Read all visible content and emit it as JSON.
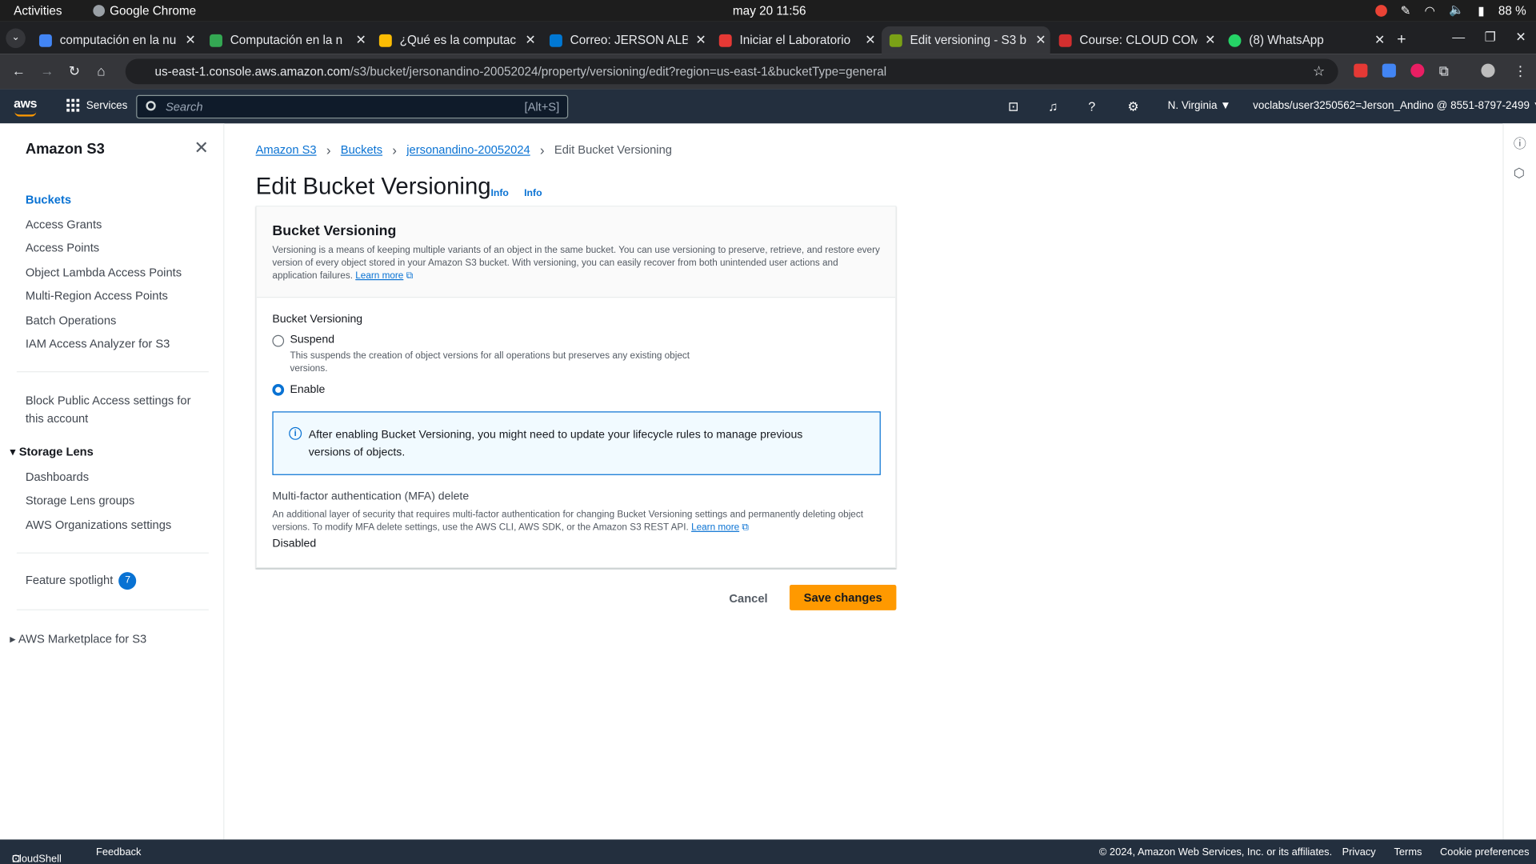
{
  "os": {
    "activities": "Activities",
    "app_name": "Google Chrome",
    "clock": "may 20  11:56",
    "battery": "88 %"
  },
  "browser": {
    "tabs": [
      {
        "title": "computación en la nu",
        "color": "#4285f4"
      },
      {
        "title": "Computación en la n",
        "color": "#34a853"
      },
      {
        "title": "¿Qué es la computac",
        "color": "#fbbc04"
      },
      {
        "title": "Correo: JERSON ALB",
        "color": "#0078d4"
      },
      {
        "title": "Iniciar el Laboratorio",
        "color": "#e53935"
      },
      {
        "title": "Edit versioning - S3 b",
        "color": "#7aa116"
      },
      {
        "title": "Course: CLOUD COM",
        "color": "#d32f2f"
      },
      {
        "title": "(8) WhatsApp",
        "color": "#25d366"
      }
    ],
    "url_host": "us-east-1.console.aws.amazon.com",
    "url_path": "/s3/bucket/jersonandino-20052024/property/versioning/edit?region=us-east-1&bucketType=general"
  },
  "aws": {
    "logo": "aws",
    "services_label": "Services",
    "search_placeholder": "Search",
    "search_shortcut": "[Alt+S]",
    "region": "N. Virginia ▼",
    "account": "voclabs/user3250562=Jerson_Andino @ 8551-8797-2499 ▼"
  },
  "sidebar": {
    "title": "Amazon S3",
    "items": [
      "Buckets",
      "Access Grants",
      "Access Points",
      "Object Lambda Access Points",
      "Multi-Region Access Points",
      "Batch Operations",
      "IAM Access Analyzer for S3"
    ],
    "block_public_1": "Block Public Access settings for",
    "block_public_2": "this account",
    "storage_lens": "Storage Lens",
    "storage_lens_items": [
      "Dashboards",
      "Storage Lens groups",
      "AWS Organizations settings"
    ],
    "feature_spotlight": "Feature spotlight",
    "feature_count": "7",
    "marketplace": "AWS Marketplace for S3"
  },
  "breadcrumb": [
    "Amazon S3",
    "Buckets",
    "jersonandino-20052024",
    "Edit Bucket Versioning"
  ],
  "page": {
    "title": "Edit Bucket Versioning",
    "info": "Info",
    "card_title": "Bucket Versioning",
    "card_desc": "Versioning is a means of keeping multiple variants of an object in the same bucket. You can use versioning to preserve, retrieve, and restore every version of every object stored in your Amazon S3 bucket. With versioning, you can easily recover from both unintended user actions and application failures.",
    "learn_more": "Learn more",
    "versioning_label": "Bucket Versioning",
    "suspend_label": "Suspend",
    "suspend_desc": "This suspends the creation of object versions for all operations but preserves any existing object versions.",
    "enable_label": "Enable",
    "selected": "Enable",
    "alert_text": "After enabling Bucket Versioning, you might need to update your lifecycle rules to manage previous versions of objects.",
    "mfa_title": "Multi-factor authentication (MFA) delete",
    "mfa_desc": "An additional layer of security that requires multi-factor authentication for changing Bucket Versioning settings and permanently deleting object versions. To modify MFA delete settings, use the AWS CLI, AWS SDK, or the Amazon S3 REST API.",
    "mfa_value": "Disabled",
    "cancel": "Cancel",
    "save": "Save changes"
  },
  "footer": {
    "cloudshell": "CloudShell",
    "feedback": "Feedback",
    "copyright": "© 2024, Amazon Web Services, Inc. or its affiliates.",
    "privacy": "Privacy",
    "terms": "Terms",
    "cookies": "Cookie preferences"
  },
  "colors": {
    "accent": "#0972d3",
    "primary_button": "#ff9900",
    "header_bg": "#232f3e"
  }
}
